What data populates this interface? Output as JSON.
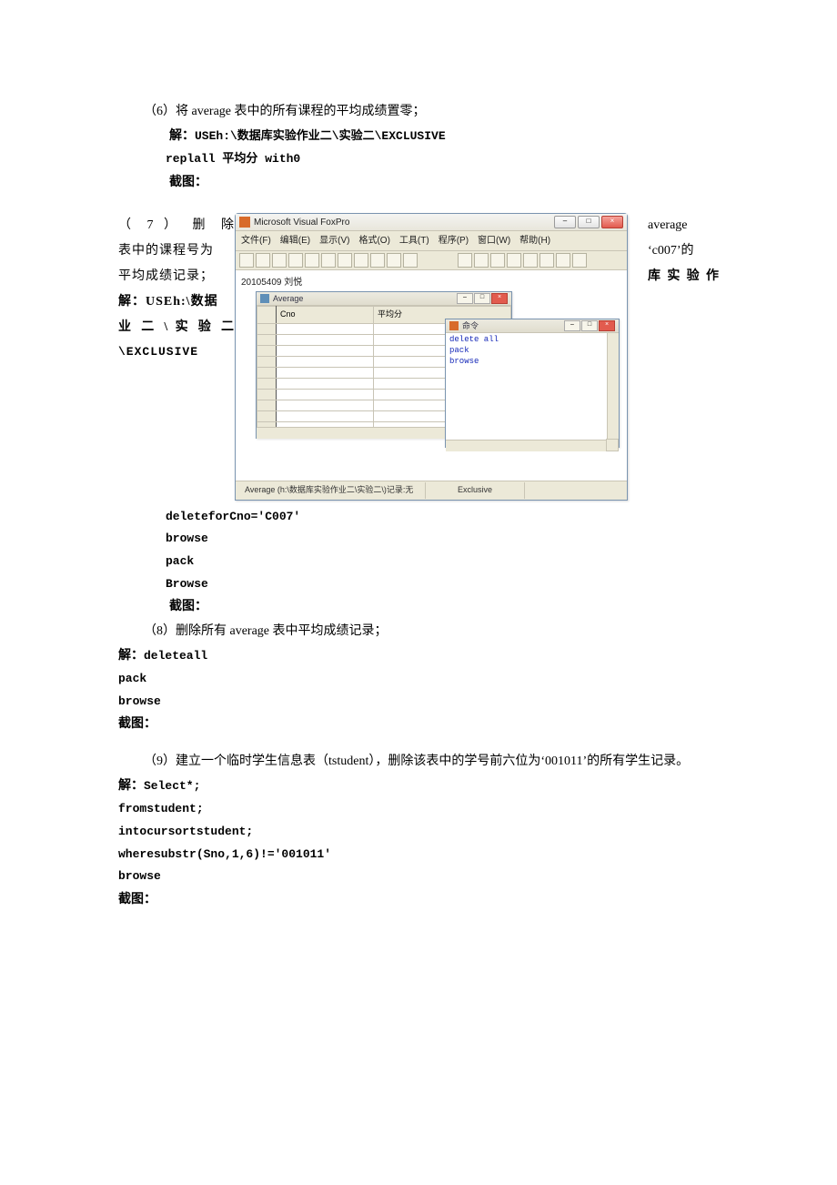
{
  "q6": {
    "title": "（6）将 average 表中的所有课程的平均成绩置零；",
    "ans_label": "解：",
    "ans_line1": "USEh:\\数据库实验作业二\\实验二\\EXCLUSIVE",
    "ans_line2": "replall 平均分 with0",
    "shot_label": "截图："
  },
  "q7": {
    "left_lines": [
      "（ 7 ） 删 除",
      "表中的课程号为",
      "平均成绩记录；",
      "解：USEh:\\数据",
      "业 二 \\  实 验 二",
      "\\EXCLUSIVE"
    ],
    "right_lines": [
      "average",
      "‘c007’的",
      "",
      "库 实 验 作",
      "",
      ""
    ],
    "code": [
      "deleteforCno='C007'",
      "browse",
      "pack",
      "Browse"
    ],
    "shot_label": "截图："
  },
  "q8": {
    "title": "（8）删除所有 average 表中平均成绩记录；",
    "ans_label": "解：",
    "code": [
      "deleteall",
      "pack",
      "browse"
    ],
    "shot_label": "截图："
  },
  "q9": {
    "title": "（9）建立一个临时学生信息表（tstudent），删除该表中的学号前六位为‘001011’的所有学生记录。",
    "ans_label": "解：",
    "code": [
      "Select*;",
      "fromstudent;",
      "intocursortstudent;",
      "wheresubstr(Sno,1,6)!='001011'",
      "browse"
    ],
    "shot_label": "截图："
  },
  "vfp": {
    "title": "Microsoft Visual FoxPro",
    "menu": [
      "文件(F)",
      "编辑(E)",
      "显示(V)",
      "格式(O)",
      "工具(T)",
      "程序(P)",
      "窗口(W)",
      "帮助(H)"
    ],
    "ws_header": "20105409   刘悦",
    "grid_title": "Average",
    "grid_cols": [
      "Cno",
      "平均分"
    ],
    "cmd_title": "命令",
    "cmd_lines": [
      "delete all",
      "pack",
      "browse"
    ],
    "status_left": "Average  (h:\\数据库实验作业二\\实验二\\)记录:无",
    "status_mid": "Exclusive"
  }
}
